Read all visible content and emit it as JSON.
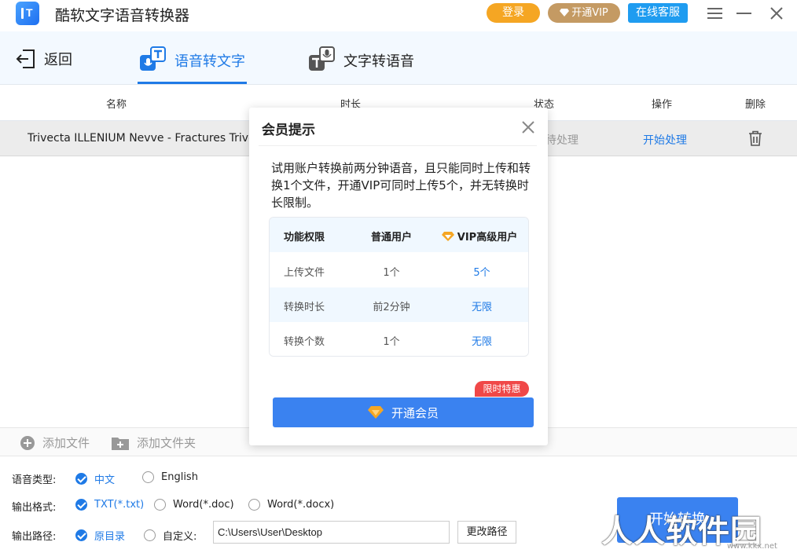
{
  "app": {
    "title": "酷软文字语音转换器"
  },
  "titlebar": {
    "login": "登录",
    "vip": "开通VIP",
    "service": "在线客服"
  },
  "nav": {
    "back": "返回",
    "tab_stt": "语音转文字",
    "tab_tts": "文字转语音"
  },
  "table": {
    "headers": {
      "name": "名称",
      "duration": "时长",
      "status": "状态",
      "action": "操作",
      "delete": "删除"
    },
    "rows": [
      {
        "name": "Trivecta ILLENIUM Nevve - Fractures Trivecta",
        "status": "待处理",
        "action": "开始处理"
      }
    ]
  },
  "addbar": {
    "add_file": "添加文件",
    "add_folder": "添加文件夹"
  },
  "settings": {
    "voice_type_label": "语音类型:",
    "voice_options": [
      "中文",
      "English"
    ],
    "voice_selected": "中文",
    "format_label": "输出格式:",
    "format_options": [
      "TXT(*.txt)",
      "Word(*.doc)",
      "Word(*.docx)"
    ],
    "format_selected": "TXT(*.txt)",
    "path_label": "输出路径:",
    "path_options": [
      "原目录",
      "自定义:"
    ],
    "path_selected": "原目录",
    "path_value": "C:\\Users\\User\\Desktop",
    "change_path": "更改路径",
    "start": "开始转换"
  },
  "modal": {
    "title": "会员提示",
    "description": "试用账户转换前两分钟语音，且只能同时上传和转换1个文件，开通VIP可同时上传5个，并无转换时长限制。",
    "table_headers": [
      "功能权限",
      "普通用户",
      "VIP高级用户"
    ],
    "table_rows": [
      [
        "上传文件",
        "1个",
        "5个"
      ],
      [
        "转换时长",
        "前2分钟",
        "无限"
      ],
      [
        "转换个数",
        "1个",
        "无限"
      ]
    ],
    "promo_tag": "限时特惠",
    "open_vip_button": "开通会员"
  },
  "watermark": {
    "text": "人人软件园",
    "url": "www.kkx.net"
  },
  "colors": {
    "accent": "#1f7ae6",
    "login": "#f5a623",
    "vip": "#c49a63",
    "service": "#1f9cf0",
    "promo": "#f04848"
  }
}
